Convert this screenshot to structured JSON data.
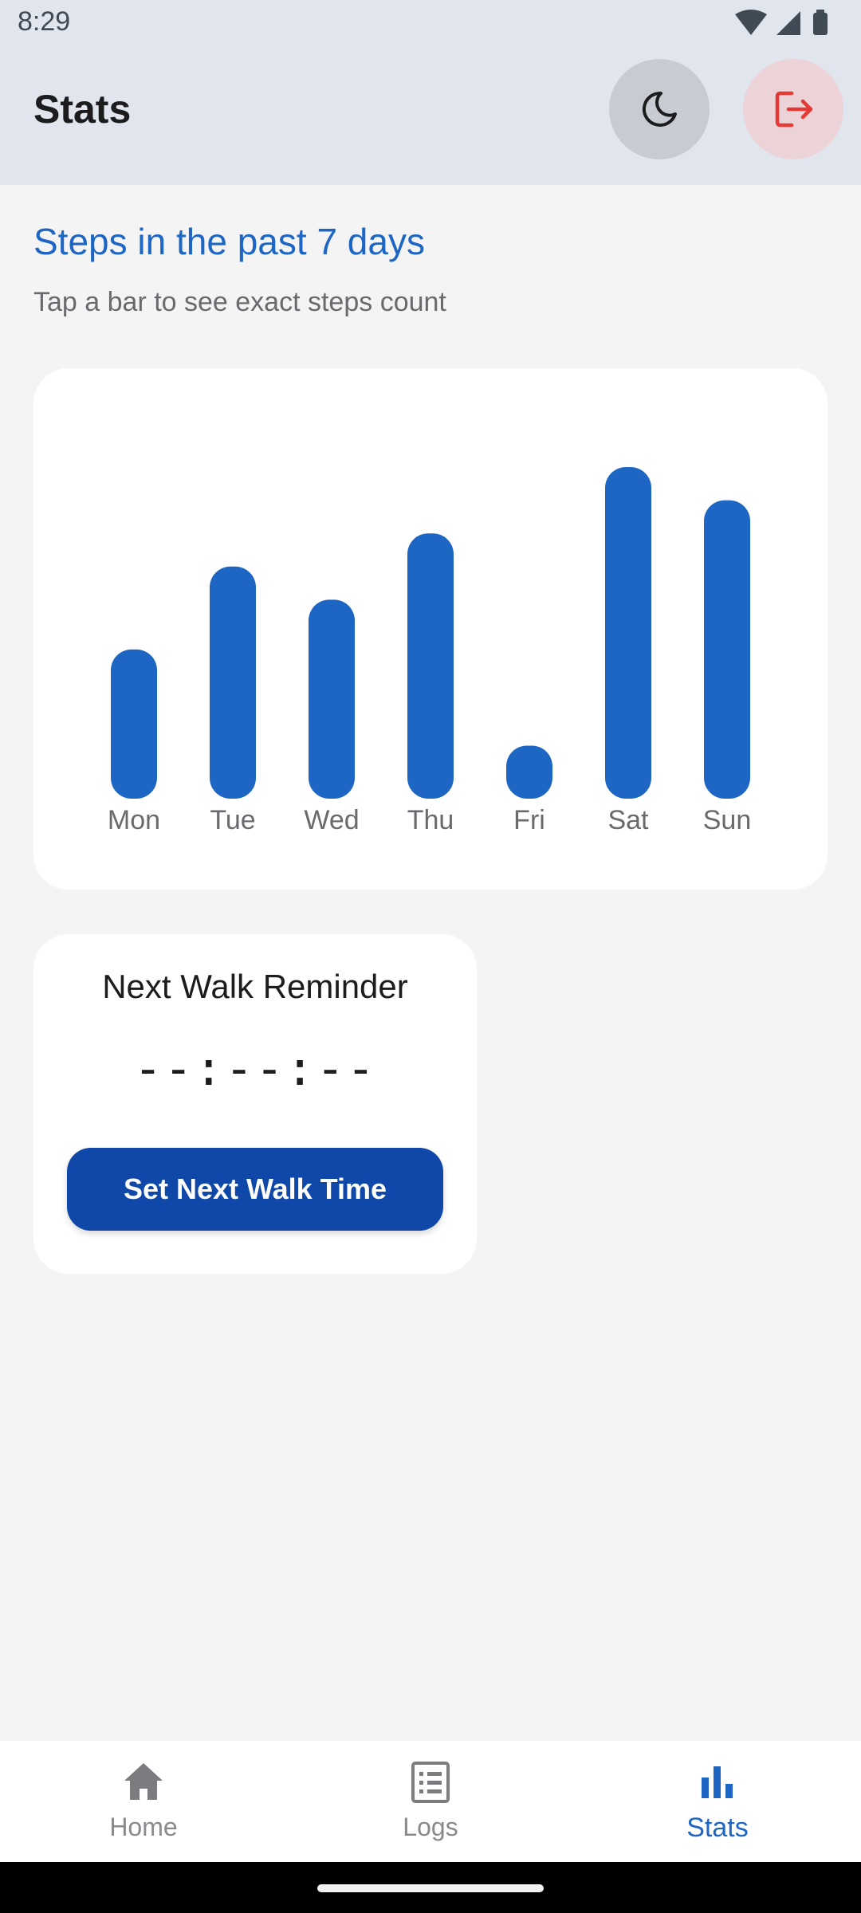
{
  "status_bar": {
    "time": "8:29",
    "icons": [
      "wifi-icon",
      "signal-icon",
      "battery-icon"
    ]
  },
  "app_bar": {
    "title": "Stats",
    "theme_icon": "moon-icon",
    "logout_icon": "logout-icon"
  },
  "section": {
    "title": "Steps in the past 7 days",
    "subtitle": "Tap a bar to see exact steps count"
  },
  "chart_data": {
    "type": "bar",
    "categories": [
      "Mon",
      "Tue",
      "Wed",
      "Thu",
      "Fri",
      "Sat",
      "Sun"
    ],
    "values": [
      0.45,
      0.7,
      0.6,
      0.8,
      0.16,
      1.0,
      0.9
    ],
    "bar_color": "#1e66c4",
    "grid": false
  },
  "reminder": {
    "title": "Next Walk Reminder",
    "time": "--:--:--",
    "button_label": "Set Next Walk Time"
  },
  "bottom_nav": {
    "items": [
      {
        "label": "Home",
        "icon": "home-icon",
        "active": false
      },
      {
        "label": "Logs",
        "icon": "list-icon",
        "active": false
      },
      {
        "label": "Stats",
        "icon": "bar-chart-icon",
        "active": true
      }
    ]
  },
  "colors": {
    "accent": "#1e66c4",
    "button": "#0f48a8",
    "logout": "#e53935"
  }
}
